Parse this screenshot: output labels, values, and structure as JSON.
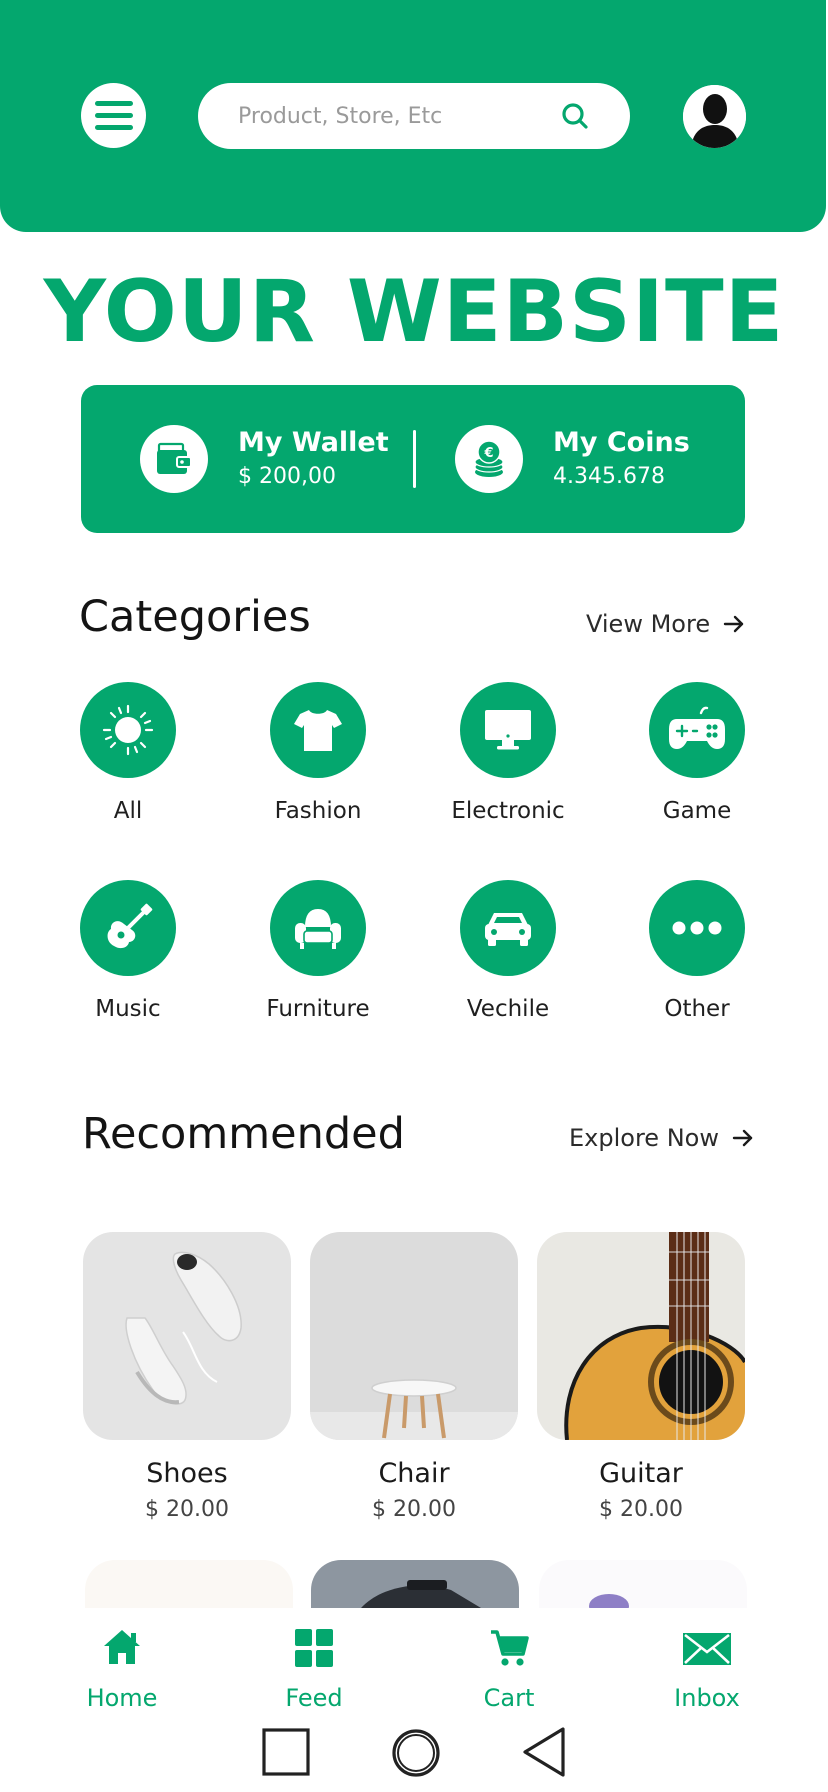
{
  "header": {
    "search_placeholder": "Product, Store, Etc"
  },
  "site_title": "YOUR WEBSITE",
  "wallet": {
    "wallet_title": "My Wallet",
    "wallet_value": "$ 200,00",
    "coins_title": "My Coins",
    "coins_value": "4.345.678"
  },
  "categories": {
    "title": "Categories",
    "link": "View More",
    "items": [
      {
        "label": "All",
        "icon": "sun-icon"
      },
      {
        "label": "Fashion",
        "icon": "tshirt-icon"
      },
      {
        "label": "Electronic",
        "icon": "monitor-icon"
      },
      {
        "label": "Game",
        "icon": "gamepad-icon"
      },
      {
        "label": "Music",
        "icon": "guitar-icon"
      },
      {
        "label": "Furniture",
        "icon": "armchair-icon"
      },
      {
        "label": "Vechile",
        "icon": "car-icon"
      },
      {
        "label": "Other",
        "icon": "more-dots-icon"
      }
    ]
  },
  "recommended": {
    "title": "Recommended",
    "link": "Explore Now",
    "items": [
      {
        "name": "Shoes",
        "price": "$ 20.00"
      },
      {
        "name": "Chair",
        "price": "$ 20.00"
      },
      {
        "name": "Guitar",
        "price": "$ 20.00"
      }
    ]
  },
  "nav": {
    "items": [
      {
        "label": "Home",
        "icon": "home-icon"
      },
      {
        "label": "Feed",
        "icon": "grid-icon"
      },
      {
        "label": "Cart",
        "icon": "cart-icon"
      },
      {
        "label": "Inbox",
        "icon": "mail-icon"
      }
    ]
  },
  "colors": {
    "brand": "#04a76e",
    "text": "#1a1a1a",
    "background": "#ffffff"
  }
}
